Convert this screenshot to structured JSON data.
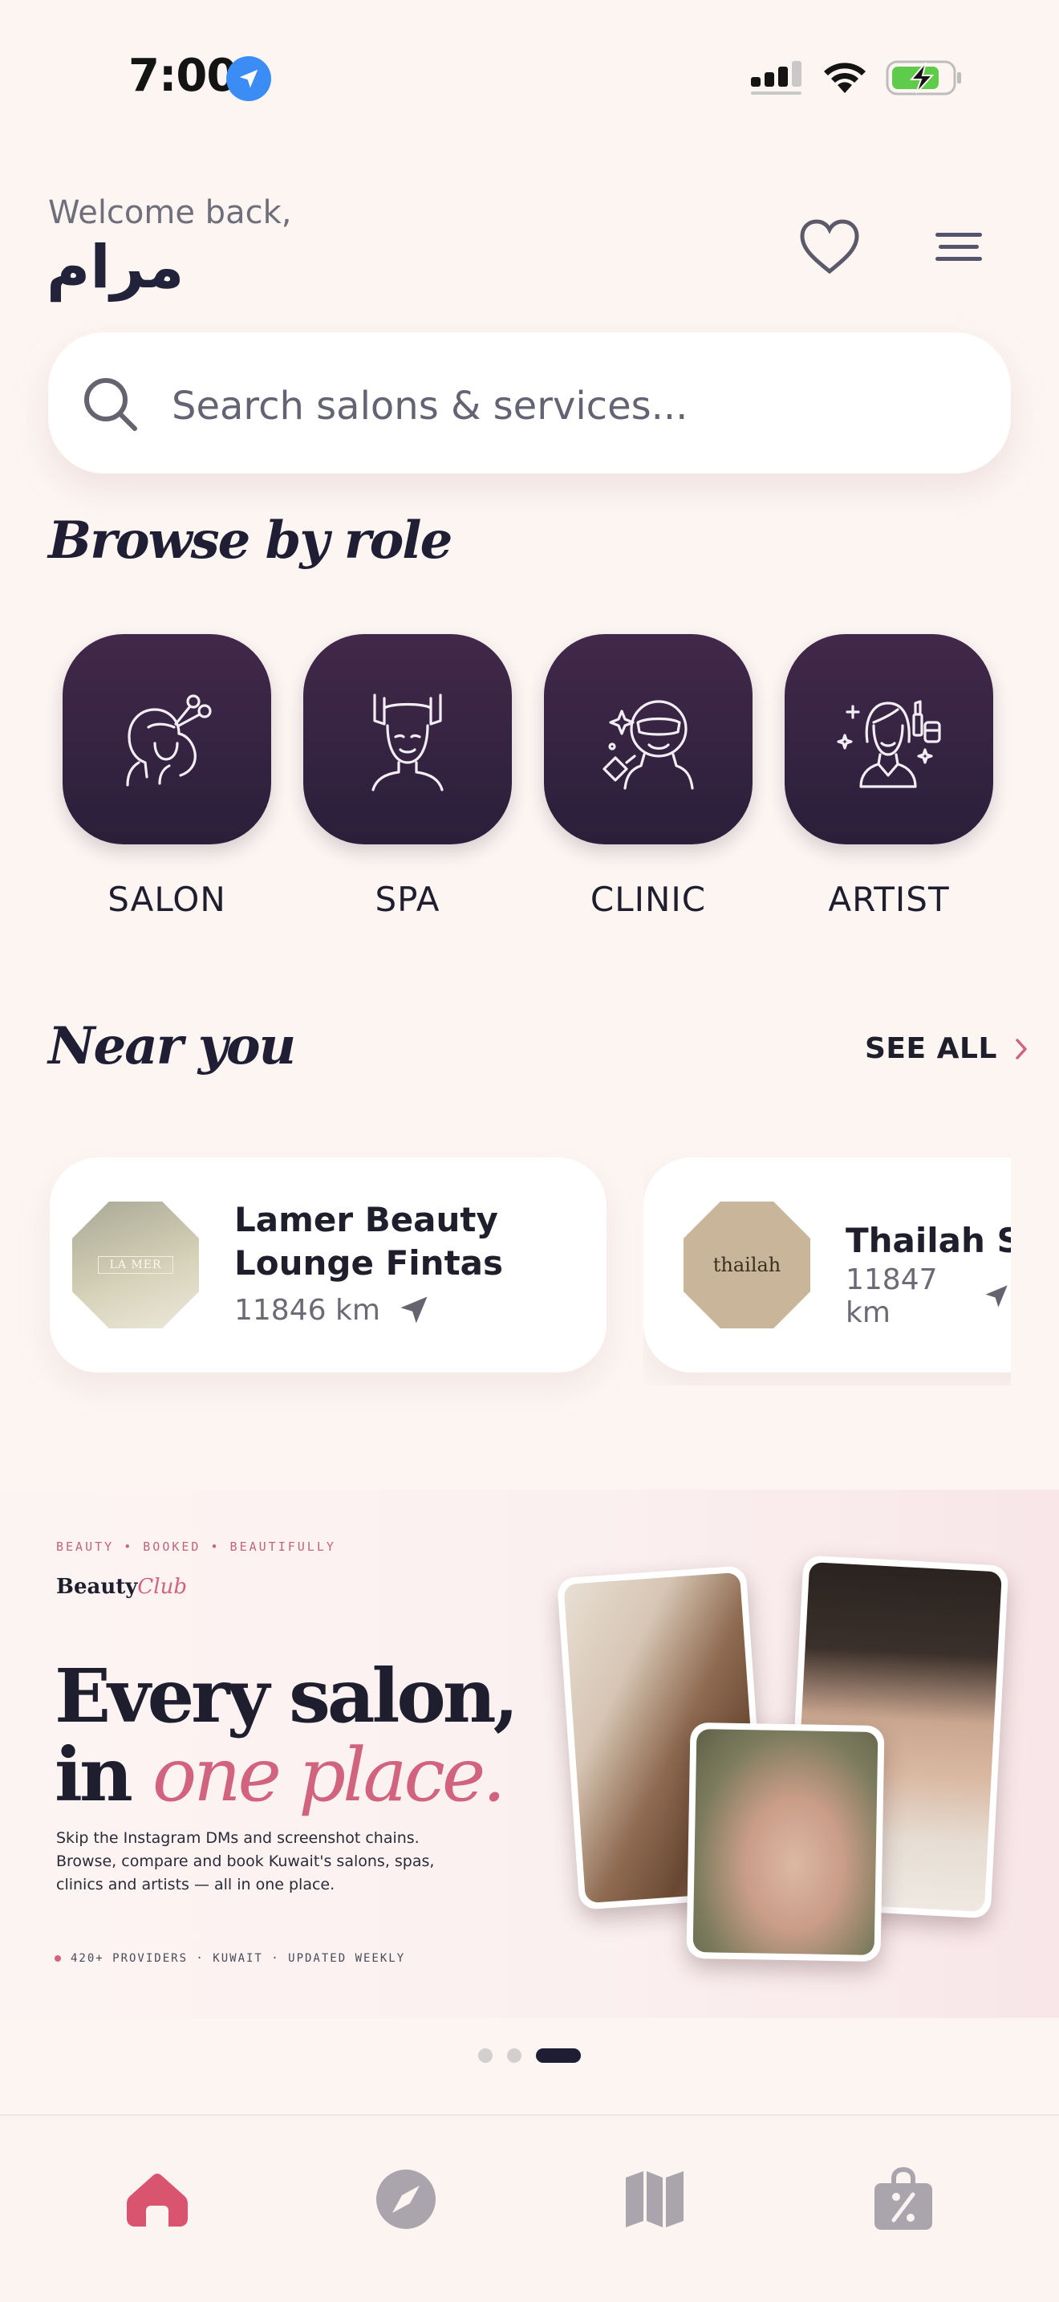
{
  "status_bar": {
    "time": "7:00"
  },
  "header": {
    "welcome": "Welcome back,",
    "user_name": "مرام"
  },
  "search": {
    "placeholder": "Search salons & services..."
  },
  "browse": {
    "title": "Browse by role",
    "roles": [
      {
        "label": "SALON",
        "icon": "salon-hairdresser-icon"
      },
      {
        "label": "SPA",
        "icon": "spa-facial-icon"
      },
      {
        "label": "CLINIC",
        "icon": "clinic-treatment-icon"
      },
      {
        "label": "ARTIST",
        "icon": "makeup-artist-icon"
      }
    ]
  },
  "near_you": {
    "title": "Near you",
    "see_all": "SEE ALL",
    "items": [
      {
        "name_line1": "Lamer Beauty",
        "name_line2": "Lounge Fintas",
        "distance": "11846 km",
        "logo_text": "LA MER"
      },
      {
        "name_line1": "Thailah Sp",
        "distance": "11847 km",
        "logo_text": "thailah"
      }
    ]
  },
  "banner": {
    "tagline": "BEAUTY • BOOKED • BEAUTIFULLY",
    "logo_a": "Beauty",
    "logo_b": "Club",
    "headline_line1": "Every salon,",
    "headline_in": "in ",
    "headline_accent": "one place.",
    "description": "Skip the Instagram DMs and screenshot chains. Browse, compare and book Kuwait's salons, spas, clinics and artists — all in one place.",
    "footer": "420+ PROVIDERS · KUWAIT · UPDATED WEEKLY",
    "page_count": 3,
    "active_page": 3
  },
  "bottom_nav": [
    {
      "name": "home",
      "icon": "home-icon",
      "active": true
    },
    {
      "name": "explore",
      "icon": "compass-icon",
      "active": false
    },
    {
      "name": "map",
      "icon": "map-icon",
      "active": false
    },
    {
      "name": "offers",
      "icon": "discount-bag-icon",
      "active": false
    }
  ],
  "colors": {
    "background": "#fcf5f2",
    "primary_dark": "#2a1f3a",
    "accent": "#d2637f",
    "active_nav": "#d9546e",
    "inactive_nav": "#aaa5ad"
  }
}
